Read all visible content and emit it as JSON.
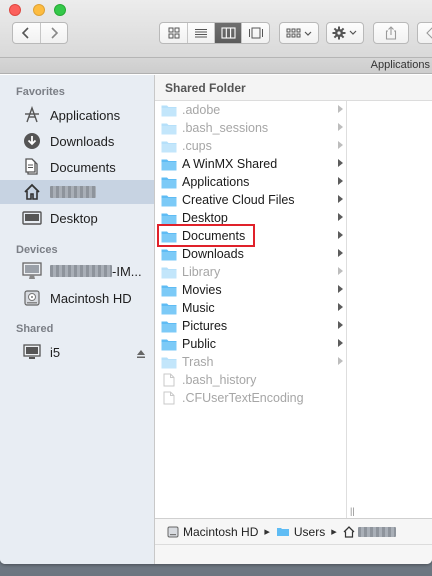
{
  "window": {
    "tab_title": "Applications",
    "column_header": "Shared Folder"
  },
  "toolbar": {
    "back": "chevron-left-icon",
    "forward": "chevron-right-icon",
    "views": [
      "icon-view",
      "list-view",
      "column-view",
      "coverflow-view"
    ],
    "active_view": "column-view"
  },
  "sidebar": {
    "sections": {
      "favorites": "Favorites",
      "devices": "Devices",
      "shared": "Shared"
    },
    "favorites": [
      {
        "label": "Applications",
        "icon": "applications-icon"
      },
      {
        "label": "Downloads",
        "icon": "downloads-icon"
      },
      {
        "label": "Documents",
        "icon": "documents-icon"
      },
      {
        "label": "",
        "icon": "home-icon",
        "redacted": true
      },
      {
        "label": "Desktop",
        "icon": "desktop-icon"
      }
    ],
    "devices": [
      {
        "label": "-IM...",
        "icon": "imac-icon"
      },
      {
        "label": "Macintosh HD",
        "icon": "disk-icon"
      }
    ],
    "shared": [
      {
        "label": "i5",
        "icon": "display-icon"
      }
    ]
  },
  "files": [
    {
      "name": ".adobe",
      "kind": "folder",
      "dim": true
    },
    {
      "name": ".bash_sessions",
      "kind": "folder",
      "dim": true
    },
    {
      "name": ".cups",
      "kind": "folder",
      "dim": true
    },
    {
      "name": "A WinMX Shared",
      "kind": "folder",
      "dim": false
    },
    {
      "name": "Applications",
      "kind": "folder",
      "dim": false
    },
    {
      "name": "Creative Cloud Files",
      "kind": "folder",
      "dim": false
    },
    {
      "name": "Desktop",
      "kind": "folder",
      "dim": false
    },
    {
      "name": "Documents",
      "kind": "folder",
      "dim": false,
      "highlighted": true
    },
    {
      "name": "Downloads",
      "kind": "folder",
      "dim": false
    },
    {
      "name": "Library",
      "kind": "folder",
      "dim": true
    },
    {
      "name": "Movies",
      "kind": "folder",
      "dim": false
    },
    {
      "name": "Music",
      "kind": "folder",
      "dim": false
    },
    {
      "name": "Pictures",
      "kind": "folder",
      "dim": false
    },
    {
      "name": "Public",
      "kind": "folder",
      "dim": false
    },
    {
      "name": "Trash",
      "kind": "folder",
      "dim": true
    },
    {
      "name": ".bash_history",
      "kind": "file",
      "dim": true
    },
    {
      "name": ".CFUserTextEncoding",
      "kind": "file",
      "dim": true
    }
  ],
  "pathbar": {
    "segments": [
      "Macintosh HD",
      "Users"
    ]
  },
  "colors": {
    "folder_blue": "#5fbcf4",
    "highlight_red": "#e0212a",
    "sidebar_selected": "#c7d3e2"
  }
}
